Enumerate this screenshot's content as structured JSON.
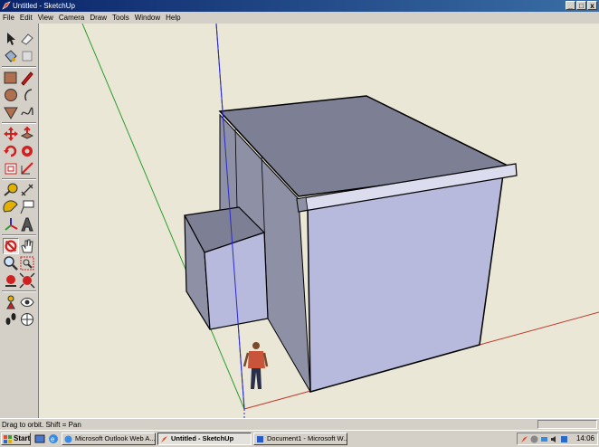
{
  "window": {
    "title": "Untitled - SketchUp",
    "min_glyph": "_",
    "max_glyph": "□",
    "close_glyph": "x"
  },
  "menu": [
    "File",
    "Edit",
    "View",
    "Camera",
    "Draw",
    "Tools",
    "Window",
    "Help"
  ],
  "tools": [
    "select-tool",
    "eraser-tool",
    "paint-bucket-tool",
    "component-tool",
    "rectangle-tool",
    "line-tool",
    "circle-tool",
    "arc-tool",
    "polygon-tool",
    "freehand-tool",
    "move-tool",
    "push-pull-tool",
    "rotate-tool",
    "follow-me-tool",
    "offset-tool",
    "scale-tool",
    "tape-measure-tool",
    "dimension-tool",
    "protractor-tool",
    "text-tool",
    "axes-tool",
    "3d-text-tool",
    "orbit-tool",
    "pan-tool",
    "zoom-tool",
    "zoom-window-tool",
    "previous-view-tool",
    "zoom-extents-tool",
    "position-camera-tool",
    "look-around-tool",
    "walk-tool",
    "section-plane-tool"
  ],
  "status": {
    "text": "Drag to orbit.  Shift = Pan",
    "measurements_value": ""
  },
  "taskbar": {
    "start_label": "Start",
    "tasks": [
      {
        "label": "Microsoft Outlook Web A...",
        "active": false
      },
      {
        "label": "Untitled - SketchUp",
        "active": true
      },
      {
        "label": "Document1 - Microsoft W...",
        "active": false
      }
    ],
    "clock": "14:06"
  },
  "colors": {
    "axis_red": "#c23a2a",
    "axis_green": "#2e9e2e",
    "axis_blue": "#2a2ac8",
    "face_front": "#b7b9dd",
    "face_side": "#8e90a6",
    "face_top": "#7d7f94",
    "sky": "#eae7d6"
  }
}
